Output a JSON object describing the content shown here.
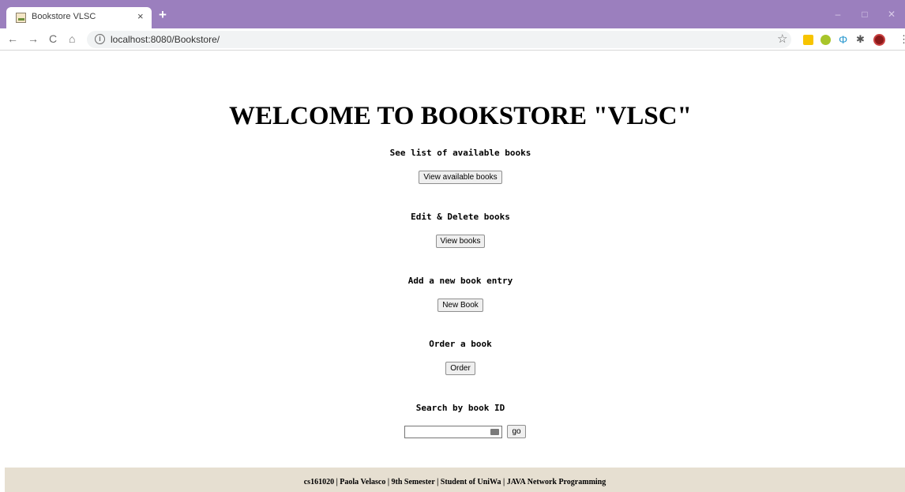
{
  "browser": {
    "tab_title": "Bookstore VLSC",
    "tab_close": "×",
    "new_tab": "+",
    "window_controls": [
      "–",
      "□",
      "✕"
    ],
    "nav": {
      "back": "←",
      "forward": "→",
      "reload": "C",
      "home": "⌂"
    },
    "url": "localhost:8080/Bookstore/",
    "info_icon": "i",
    "bookmark_icon": "☆",
    "extensions": [
      "yellow-extension-icon",
      "green-extension-icon",
      "blue-extension-icon",
      "puzzle-extension-icon"
    ],
    "menu_icon": "⋮",
    "colors": {
      "tab_strip": "#9b7fbe",
      "omnibox": "#f1f3f4"
    }
  },
  "page": {
    "title": "WELCOME TO BOOKSTORE \"VLSC\"",
    "sections": [
      {
        "heading": "See list of available books",
        "button": "View available books"
      },
      {
        "heading": "Edit & Delete books",
        "button": "View books"
      },
      {
        "heading": "Add a new book entry",
        "button": "New Book"
      },
      {
        "heading": "Order a book",
        "button": "Order"
      },
      {
        "heading": "Search by book ID",
        "input_value": "",
        "button": "go"
      }
    ],
    "footer": "cs161020 | Paola Velasco | 9th Semester | Student of UniWa | JAVA Network Programming",
    "colors": {
      "footer_bg": "#e6dfd1"
    }
  }
}
